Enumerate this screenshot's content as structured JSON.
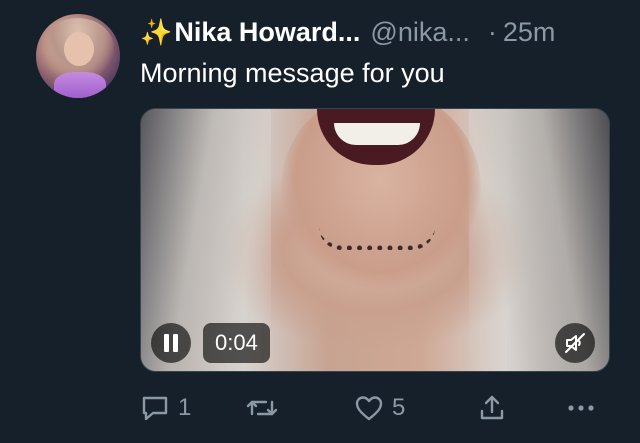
{
  "tweet": {
    "emoji": "✨",
    "display_name": "Nika Howard...",
    "handle": "@nika...",
    "separator": "·",
    "time": "25m",
    "text": "Morning message for you"
  },
  "media": {
    "type": "video",
    "timecode": "0:04",
    "state": "playing",
    "muted": true
  },
  "actions": {
    "reply_count": "1",
    "like_count": "5"
  },
  "icons": {
    "reply": "reply-icon",
    "retweet": "retweet-icon",
    "like": "heart-icon",
    "share": "share-icon",
    "more": "more-icon",
    "pause": "pause-icon",
    "mute": "muted-speaker-icon"
  },
  "colors": {
    "background": "#16202a",
    "secondary_text": "#8b98a5",
    "primary_text": "#ffffff"
  }
}
